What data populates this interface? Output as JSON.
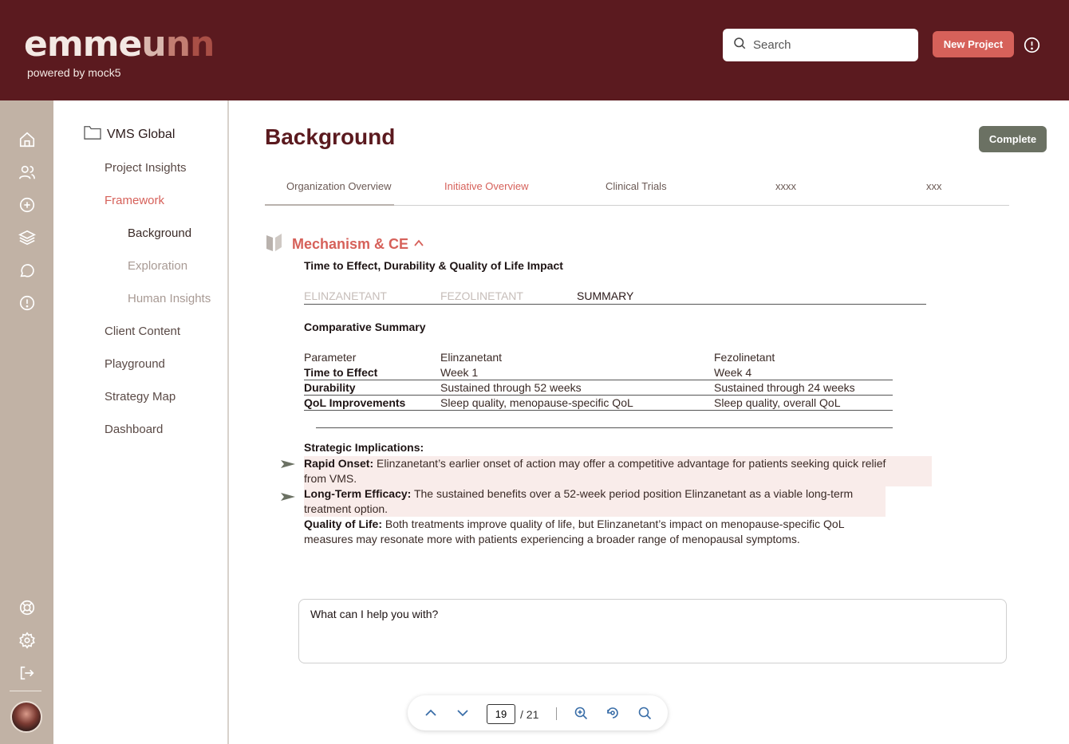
{
  "header": {
    "logo_main": "emme",
    "logo_tail": [
      "u",
      "n",
      "n"
    ],
    "tagline": "powered by mock5",
    "search_placeholder": "Search",
    "new_project_label": "New Project"
  },
  "rail": {
    "top_icons": [
      "home-icon",
      "users-icon",
      "plus-circle-icon",
      "layers-icon",
      "chat-icon",
      "alert-icon"
    ],
    "bottom_icons": [
      "lifebuoy-icon",
      "gear-icon",
      "logout-icon"
    ]
  },
  "nav": {
    "root": "VMS Global",
    "items": [
      {
        "label": "Project Insights"
      },
      {
        "label": "Framework"
      },
      {
        "label": "Background"
      },
      {
        "label": "Exploration"
      },
      {
        "label": "Human Insights"
      },
      {
        "label": "Client Content"
      },
      {
        "label": "Playground"
      },
      {
        "label": "Strategy Map"
      },
      {
        "label": "Dashboard"
      }
    ]
  },
  "main": {
    "title": "Background",
    "complete_label": "Complete",
    "tabs": [
      {
        "label": "Organization Overview"
      },
      {
        "label": "Initiative Overview"
      },
      {
        "label": "Clinical Trials"
      },
      {
        "label": "xxxx"
      },
      {
        "label": "xxx"
      }
    ],
    "section": {
      "title": "Mechanism & CE",
      "subtitle": "Time to Effect, Durability & Quality of Life Impact",
      "subtabs": [
        {
          "label": "ELINZANETANT"
        },
        {
          "label": "FEZOLINETANT"
        },
        {
          "label": "SUMMARY"
        }
      ],
      "comparative_title": "Comparative Summary",
      "table": {
        "header": [
          "Parameter",
          "Elinzanetant",
          "Fezolinetant"
        ],
        "rows": [
          [
            "Time to Effect",
            "Week 1",
            "Week 4"
          ],
          [
            "Durability",
            "Sustained through 52 weeks",
            "Sustained through 24 weeks"
          ],
          [
            "QoL Improvements",
            "Sleep quality, menopause-specific QoL",
            "Sleep quality, overall QoL"
          ]
        ]
      },
      "implications_title": "Strategic Implications:",
      "implications": [
        {
          "label": "Rapid Onset:",
          "line1": " Elinzanetant’s earlier onset of action may offer a competitive advantage for patients seeking quick relief",
          "line2": "from VMS."
        },
        {
          "label": "Long-Term Efficacy:",
          "line1": " The sustained benefits over a 52-week period position Elinzanetant as a viable long-term",
          "line2": "treatment option."
        },
        {
          "label": "Quality of Life:",
          "line1": " Both treatments improve quality of life, but Elinzanetant’s impact on menopause-specific QoL",
          "line2": "measures may resonate more with patients experiencing a broader range of menopausal symptoms."
        }
      ]
    },
    "chat_placeholder": "What can I help you with?"
  },
  "pager": {
    "current_page": "19",
    "total": "/ 21"
  },
  "colors": {
    "brand_dark": "#5b1a1f",
    "accent": "#d6615a",
    "rail": "#c1b2a5",
    "complete": "#6b7163"
  }
}
